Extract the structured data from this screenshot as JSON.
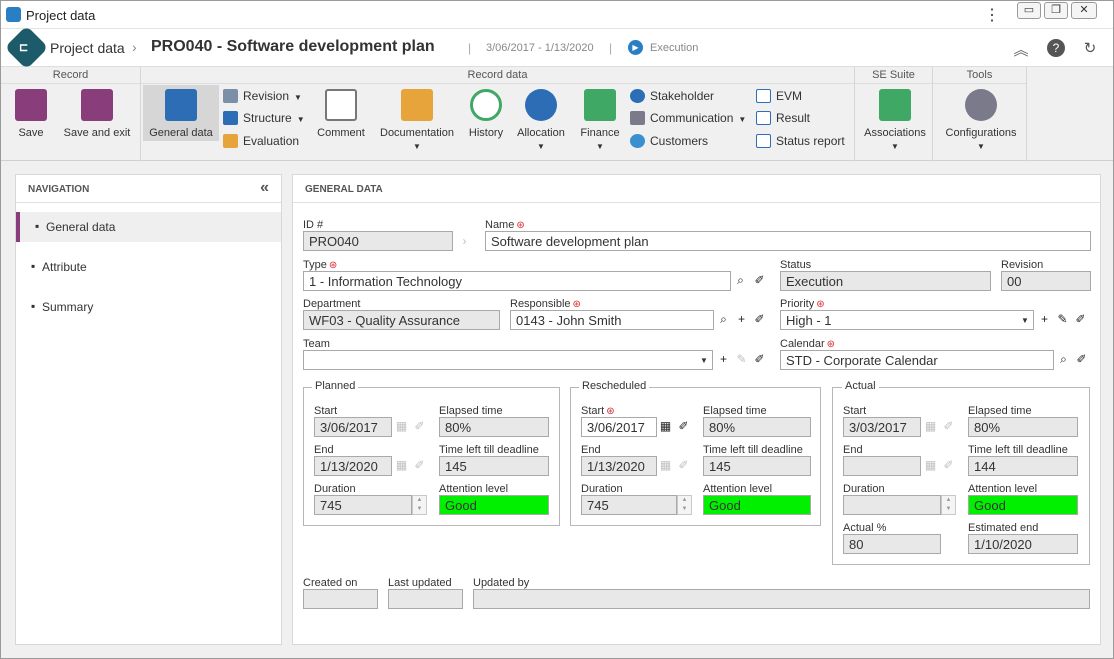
{
  "window": {
    "title": "Project data",
    "kebab": "⋮",
    "minimize": "▭",
    "restore": "❐",
    "close": "✕"
  },
  "header": {
    "app_name": "Project data",
    "record_title": "PRO040 - Software development plan",
    "dates": "3/06/2017 - 1/13/2020",
    "status": "Execution",
    "sep": "|",
    "chevron": "›"
  },
  "ribbon": {
    "groups": {
      "record": "Record",
      "record_data": "Record data",
      "se_suite": "SE Suite",
      "tools": "Tools"
    },
    "save": "Save",
    "save_exit": "Save and exit",
    "general": "General data",
    "revision": "Revision",
    "structure": "Structure",
    "evaluation": "Evaluation",
    "comment": "Comment",
    "documentation": "Documentation",
    "history": "History",
    "allocation": "Allocation",
    "finance": "Finance",
    "stakeholder": "Stakeholder",
    "communication": "Communication",
    "customers": "Customers",
    "evm": "EVM",
    "result": "Result",
    "status_report": "Status report",
    "associations": "Associations",
    "configurations": "Configurations"
  },
  "nav": {
    "title": "NAVIGATION",
    "items": [
      {
        "label": "General data"
      },
      {
        "label": "Attribute"
      },
      {
        "label": "Summary"
      }
    ]
  },
  "form": {
    "title": "GENERAL DATA",
    "id_label": "ID #",
    "id": "PRO040",
    "name_label": "Name",
    "name": "Software development plan",
    "type_label": "Type",
    "type": "1 - Information Technology",
    "status_label": "Status",
    "status": "Execution",
    "revision_label": "Revision",
    "revision": "00",
    "department_label": "Department",
    "department": "WF03 - Quality Assurance",
    "responsible_label": "Responsible",
    "responsible": "0143 - John Smith",
    "priority_label": "Priority",
    "priority": "High - 1",
    "team_label": "Team",
    "team": "",
    "calendar_label": "Calendar",
    "calendar": "STD - Corporate Calendar",
    "planned": {
      "title": "Planned",
      "start_label": "Start",
      "start": "3/06/2017",
      "elapsed_label": "Elapsed time",
      "elapsed": "80%",
      "end_label": "End",
      "end": "1/13/2020",
      "left_label": "Time left till deadline",
      "left": "145",
      "duration_label": "Duration",
      "duration": "745",
      "attention_label": "Attention level",
      "attention": "Good"
    },
    "rescheduled": {
      "title": "Rescheduled",
      "start_label": "Start",
      "start": "3/06/2017",
      "elapsed_label": "Elapsed time",
      "elapsed": "80%",
      "end_label": "End",
      "end": "1/13/2020",
      "left_label": "Time left till deadline",
      "left": "145",
      "duration_label": "Duration",
      "duration": "745",
      "attention_label": "Attention level",
      "attention": "Good"
    },
    "actual": {
      "title": "Actual",
      "start_label": "Start",
      "start": "3/03/2017",
      "elapsed_label": "Elapsed time",
      "elapsed": "80%",
      "end_label": "End",
      "end": "",
      "left_label": "Time left till deadline",
      "left": "144",
      "duration_label": "Duration",
      "duration": "",
      "attention_label": "Attention level",
      "attention": "Good",
      "actual_pct_label": "Actual %",
      "actual_pct": "80",
      "estimated_end_label": "Estimated end",
      "estimated_end": "1/10/2020"
    },
    "created_label": "Created on",
    "created": "",
    "updated_label": "Last updated",
    "updated": "",
    "updated_by_label": "Updated by",
    "updated_by": ""
  },
  "colors": {
    "accent": "#8a3d7b",
    "good": "#00f000",
    "brand": "#1d5a6a"
  }
}
